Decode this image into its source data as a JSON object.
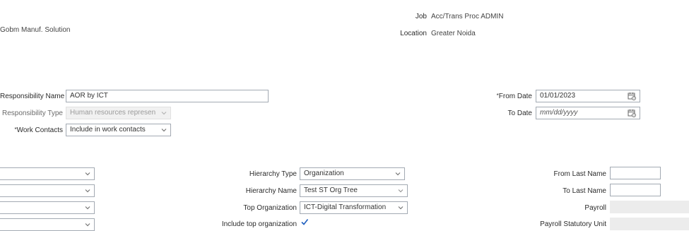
{
  "header": {
    "org_text": "Gobm Manuf. Solution",
    "job_label": "Job",
    "job_value": "Acc/Trans Proc ADMIN",
    "location_label": "Location",
    "location_value": "Greater Noida"
  },
  "responsibility": {
    "name_label": "Responsibility Name",
    "name_value": "AOR by ICT",
    "type_label": "Responsibility Type",
    "type_value": "Human resources represen",
    "work_contacts_label": "Work Contacts",
    "work_contacts_value": "Include in work contacts",
    "from_date_label": "From Date",
    "from_date_value": "01/01/2023",
    "to_date_label": "To Date",
    "to_date_placeholder": "mm/dd/yyyy",
    "required_marker": "*"
  },
  "scope": {
    "hierarchy_type_label": "Hierarchy Type",
    "hierarchy_type_value": "Organization",
    "hierarchy_name_label": "Hierarchy Name",
    "hierarchy_name_value": "Test ST Org Tree",
    "top_org_label": "Top Organization",
    "top_org_value": "ICT-Digital Transformation",
    "include_top_label": "Include top organization",
    "include_top_checked": true,
    "from_last_name_label": "From Last Name",
    "from_last_name_value": "",
    "to_last_name_label": "To Last Name",
    "to_last_name_value": "",
    "payroll_label": "Payroll",
    "payroll_value": "",
    "payroll_statutory_unit_label": "Payroll Statutory Unit",
    "payroll_statutory_unit_value": ""
  },
  "left_selects": [
    "",
    "",
    "",
    ""
  ],
  "colors": {
    "border": "#a3aab3",
    "disabled_bg": "#f1f1f1",
    "readonly_bg": "#ececec",
    "checkbox_blue": "#1f5fbf"
  }
}
